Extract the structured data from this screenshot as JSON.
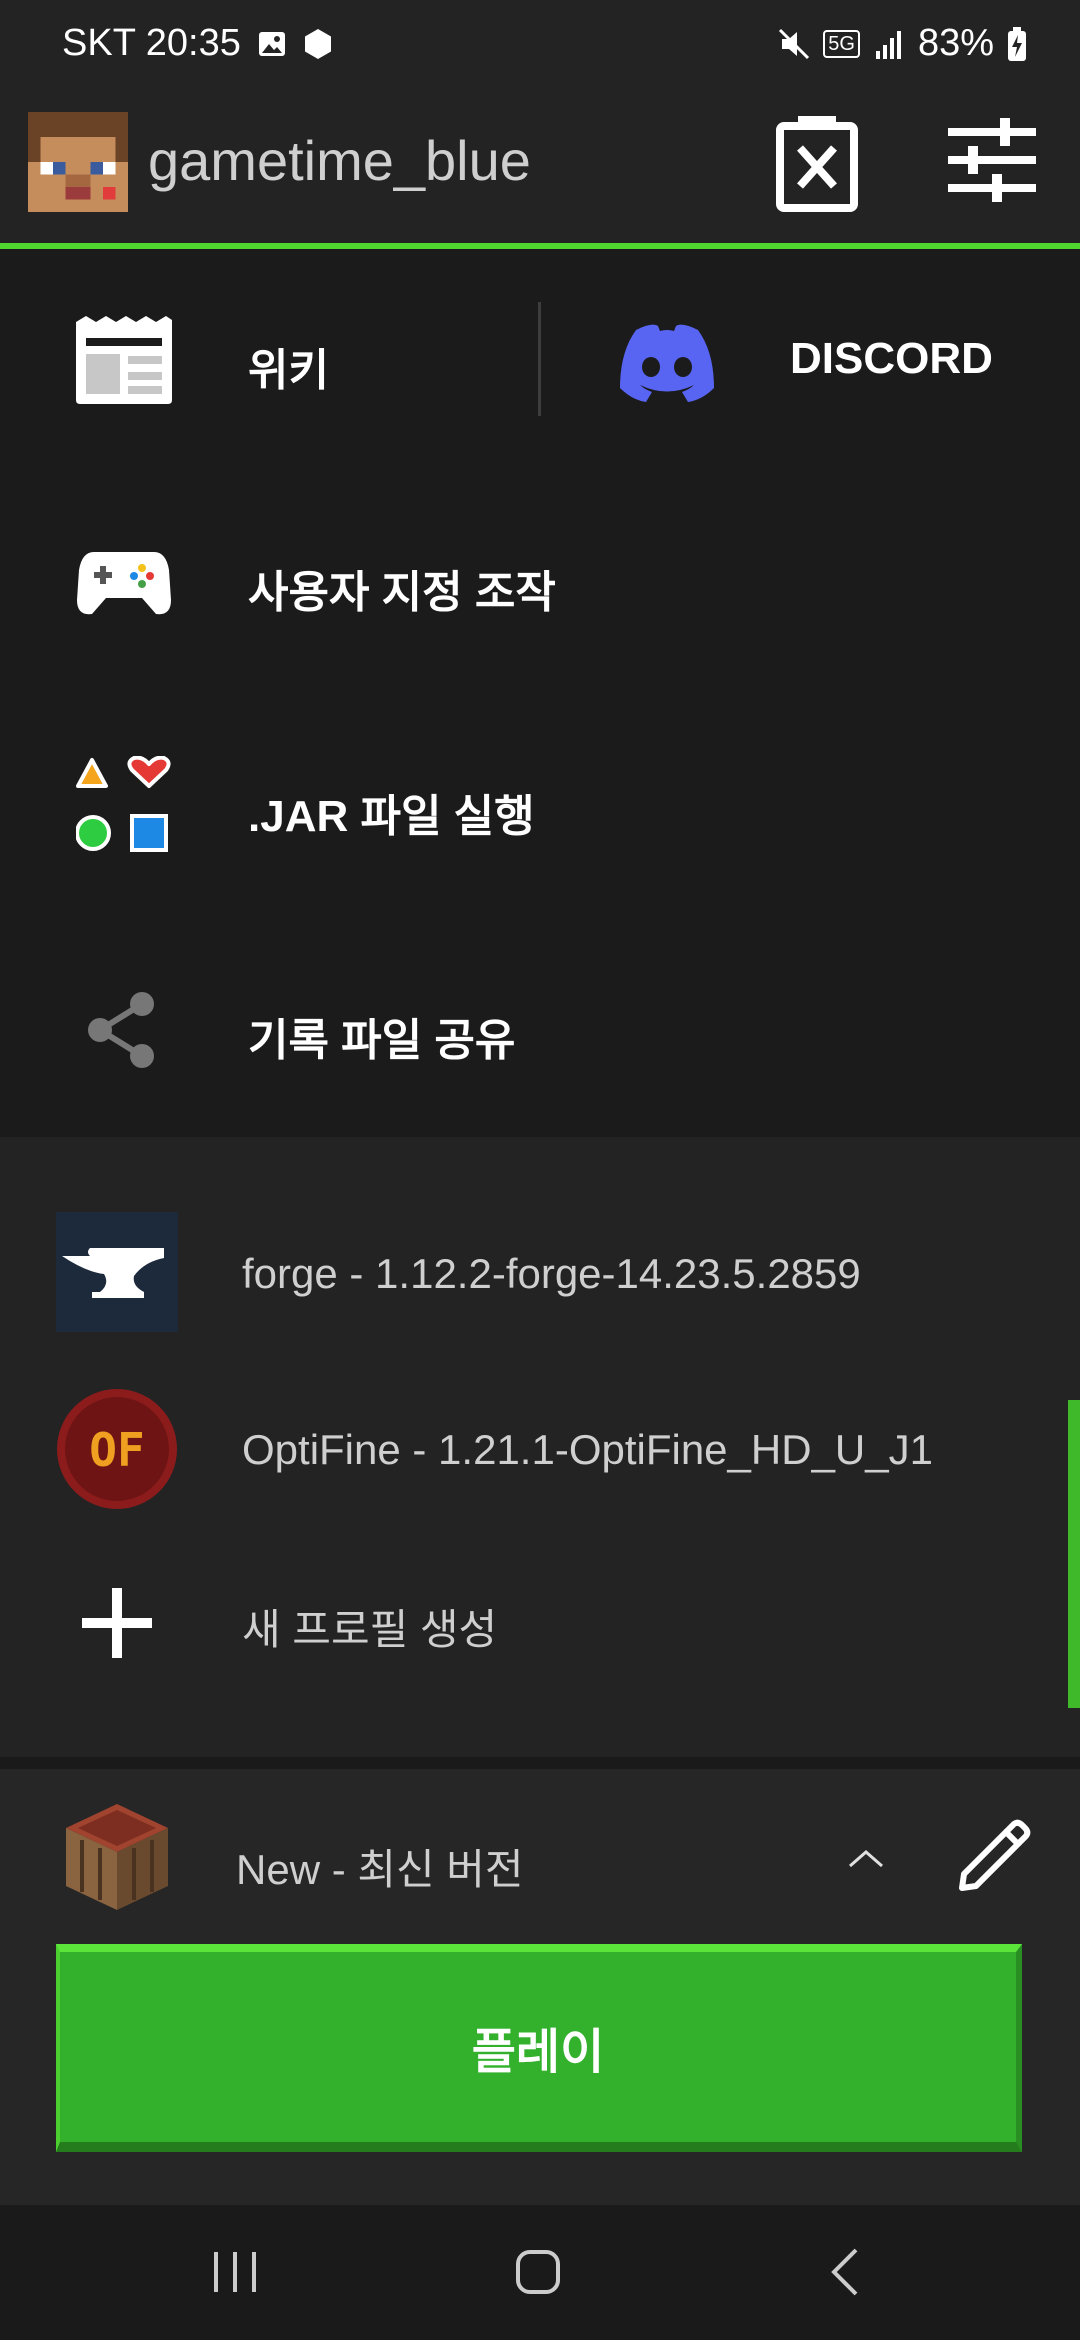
{
  "status_bar": {
    "carrier_time": "SKT 20:35",
    "network": "5G",
    "battery": "83%"
  },
  "header": {
    "username": "gametime_blue"
  },
  "menu": {
    "wiki": "위키",
    "discord": "DISCORD",
    "custom_controls": "사용자 지정 조작",
    "run_jar": ".JAR 파일 실행",
    "share_logs": "기록 파일 공유"
  },
  "profiles": {
    "items": [
      {
        "label": "forge - 1.12.2-forge-14.23.5.2859",
        "icon": "anvil-icon"
      },
      {
        "label": "OptiFine - 1.21.1-OptiFine_HD_U_J1",
        "icon": "optifine-icon"
      }
    ],
    "create_new": "새 프로필 생성"
  },
  "bottom": {
    "selected_version": "New - 최신 버전",
    "play_label": "플레이"
  },
  "colors": {
    "accent": "#4fd62f",
    "play_button": "#33b12d",
    "discord": "#5865f2",
    "background": "#232323",
    "panel": "#1b1b1b"
  }
}
